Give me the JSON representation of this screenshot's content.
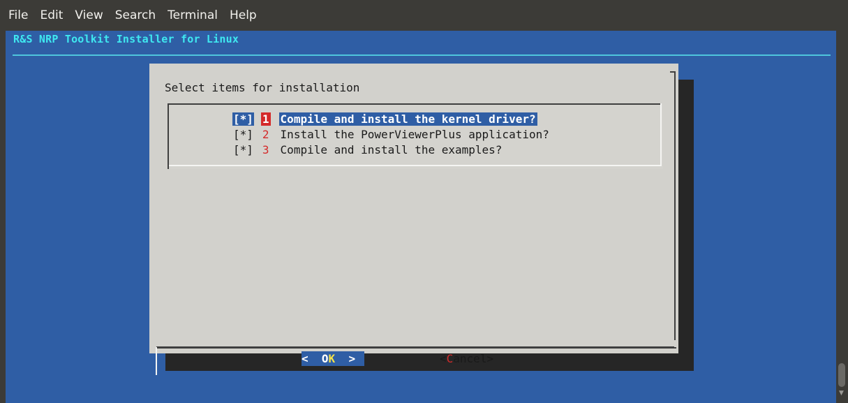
{
  "menubar": {
    "items": [
      "File",
      "Edit",
      "View",
      "Search",
      "Terminal",
      "Help"
    ]
  },
  "terminal": {
    "title": "R&S NRP Toolkit Installer for Linux"
  },
  "dialog": {
    "prompt": "Select items for installation",
    "items": [
      {
        "check": "[*]",
        "tag": "1",
        "text": "Compile and install the kernel driver?",
        "selected": true
      },
      {
        "check": "[*]",
        "tag": "2",
        "text": "Install the PowerViewerPlus application?",
        "selected": false
      },
      {
        "check": "[*]",
        "tag": "3",
        "text": "Compile and install the examples?",
        "selected": false
      }
    ],
    "ok_button": {
      "prefix": "<  O",
      "hotkey": "K",
      "suffix": "  >"
    },
    "cancel_button": {
      "prefix": "<",
      "hotkey": "C",
      "suffix": "ancel>"
    }
  },
  "colors": {
    "terminal_bg": "#2f5ea5",
    "dialog_bg": "#d2d1cc",
    "title_cyan": "#3fe8f0",
    "hotkey_red": "#d42a2a",
    "hotkey_yellow": "#f4e24a"
  }
}
